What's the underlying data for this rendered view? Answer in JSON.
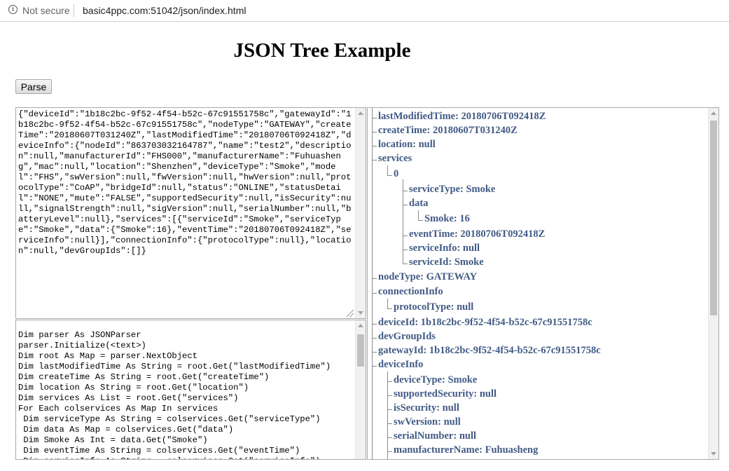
{
  "browser": {
    "security_label": "Not secure",
    "url": "basic4ppc.com:51042/json/index.html"
  },
  "page": {
    "title": "JSON Tree Example",
    "parse_button": "Parse"
  },
  "json_input": {
    "text": "{\"deviceId\":\"1b18c2bc-9f52-4f54-b52c-67c91551758c\",\"gatewayId\":\"1b18c2bc-9f52-4f54-b52c-67c91551758c\",\"nodeType\":\"GATEWAY\",\"createTime\":\"20180607T031240Z\",\"lastModifiedTime\":\"20180706T092418Z\",\"deviceInfo\":{\"nodeId\":\"863703032164787\",\"name\":\"test2\",\"description\":null,\"manufacturerId\":\"FHS000\",\"manufacturerName\":\"Fuhuasheng\",\"mac\":null,\"location\":\"Shenzhen\",\"deviceType\":\"Smoke\",\"model\":\"FHS\",\"swVersion\":null,\"fwVersion\":null,\"hwVersion\":null,\"protocolType\":\"CoAP\",\"bridgeId\":null,\"status\":\"ONLINE\",\"statusDetail\":\"NONE\",\"mute\":\"FALSE\",\"supportedSecurity\":null,\"isSecurity\":null,\"signalStrength\":null,\"sigVersion\":null,\"serialNumber\":null,\"batteryLevel\":null},\"services\":[{\"serviceId\":\"Smoke\",\"serviceType\":\"Smoke\",\"data\":{\"Smoke\":16},\"eventTime\":\"20180706T092418Z\",\"serviceInfo\":null}],\"connectionInfo\":{\"protocolType\":null},\"location\":null,\"devGroupIds\":[]}"
  },
  "code_output": {
    "lines": [
      "Dim parser As JSONParser",
      "parser.Initialize(<text>)",
      "Dim root As Map = parser.NextObject",
      "Dim lastModifiedTime As String = root.Get(\"lastModifiedTime\")",
      "Dim createTime As String = root.Get(\"createTime\")",
      "Dim location As String = root.Get(\"location\")",
      "Dim services As List = root.Get(\"services\")",
      "For Each colservices As Map In services",
      " Dim serviceType As String = colservices.Get(\"serviceType\")",
      " Dim data As Map = colservices.Get(\"data\")",
      " Dim Smoke As Int = data.Get(\"Smoke\")",
      " Dim eventTime As String = colservices.Get(\"eventTime\")",
      " Dim serviceInfo As String = colservices.Get(\"serviceInfo\")"
    ]
  },
  "tree": {
    "nodes": [
      {
        "text": "lastModifiedTime: 20180706T092418Z",
        "level": 0
      },
      {
        "text": "createTime: 20180607T031240Z",
        "level": 0
      },
      {
        "text": "location: null",
        "level": 0
      },
      {
        "text": "services",
        "level": 0
      },
      {
        "text": "0",
        "level": 1
      },
      {
        "text": "serviceType: Smoke",
        "level": 2
      },
      {
        "text": "data",
        "level": 2
      },
      {
        "text": "Smoke: 16",
        "level": 3
      },
      {
        "text": "eventTime: 20180706T092418Z",
        "level": 2
      },
      {
        "text": "serviceInfo: null",
        "level": 2
      },
      {
        "text": "serviceId: Smoke",
        "level": 2
      },
      {
        "text": "nodeType: GATEWAY",
        "level": 0
      },
      {
        "text": "connectionInfo",
        "level": 0
      },
      {
        "text": "protocolType: null",
        "level": 1
      },
      {
        "text": "deviceId: 1b18c2bc-9f52-4f54-b52c-67c91551758c",
        "level": 0
      },
      {
        "text": "devGroupIds",
        "level": 0
      },
      {
        "text": "gatewayId: 1b18c2bc-9f52-4f54-b52c-67c91551758c",
        "level": 0
      },
      {
        "text": "deviceInfo",
        "level": 0
      },
      {
        "text": "deviceType: Smoke",
        "level": 1
      },
      {
        "text": "supportedSecurity: null",
        "level": 1
      },
      {
        "text": "isSecurity: null",
        "level": 1
      },
      {
        "text": "swVersion: null",
        "level": 1
      },
      {
        "text": "serialNumber: null",
        "level": 1
      },
      {
        "text": "manufacturerName: Fuhuasheng",
        "level": 1
      }
    ]
  },
  "icons": {
    "info": "info-circle-icon",
    "scroll_up": "scroll-up-arrow-icon",
    "scroll_down": "scroll-down-arrow-icon",
    "resize": "resize-grip-icon"
  },
  "colors": {
    "tree_text": "#415a85"
  }
}
